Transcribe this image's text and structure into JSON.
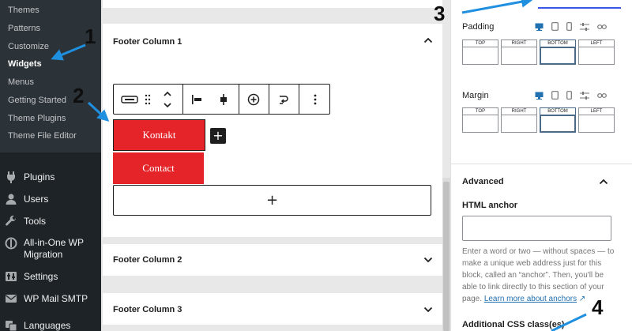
{
  "sidebar": {
    "submenu": [
      {
        "label": "Themes",
        "current": false
      },
      {
        "label": "Patterns",
        "current": false
      },
      {
        "label": "Customize",
        "current": false
      },
      {
        "label": "Widgets",
        "current": true
      },
      {
        "label": "Menus",
        "current": false
      },
      {
        "label": "Getting Started",
        "current": false
      },
      {
        "label": "Theme Plugins",
        "current": false
      },
      {
        "label": "Theme File Editor",
        "current": false
      }
    ],
    "menu": [
      {
        "label": "Plugins",
        "icon": "plug-icon"
      },
      {
        "label": "Users",
        "icon": "users-icon"
      },
      {
        "label": "Tools",
        "icon": "wrench-icon"
      },
      {
        "label": "All-in-One WP",
        "label2": "Migration",
        "icon": "migration-icon"
      },
      {
        "label": "Settings",
        "icon": "settings-icon"
      },
      {
        "label": "WP Mail SMTP",
        "icon": "mail-icon"
      },
      {
        "label": "Languages",
        "icon": "languages-icon"
      }
    ]
  },
  "canvas": {
    "panels": {
      "col1": "Footer Column 1",
      "col2": "Footer Column 2",
      "col3": "Footer Column 3"
    },
    "buttons": {
      "kontakt": "Kontakt",
      "contact": "Contact"
    },
    "inline_add": "+",
    "appender": "+"
  },
  "inspector": {
    "padding_label": "Padding",
    "margin_label": "Margin",
    "sides": [
      "TOP",
      "RIGHT",
      "BOTTOM",
      "LEFT"
    ],
    "advanced_label": "Advanced",
    "html_anchor_label": "HTML anchor",
    "html_anchor_value": "",
    "help_text": "Enter a word or two — without spaces — to make a unique web address just for this block, called an “anchor”. Then, you'll be able to link directly to this section of your page.",
    "help_link": "Learn more about anchors",
    "help_link_glyph": "↗",
    "css_class_label": "Additional CSS class(es)"
  },
  "annotations": [
    "1",
    "2",
    "3",
    "4"
  ],
  "colors": {
    "admin_bg": "#1d2327",
    "submenu_bg": "#2c3338",
    "button_red": "#e5242a",
    "annotation_blue": "#1f8fe0"
  }
}
